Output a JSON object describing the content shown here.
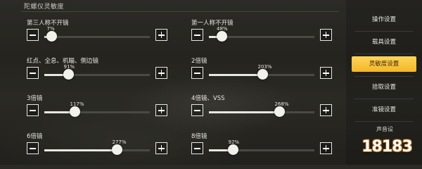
{
  "section_title": "陀螺仪灵敏度",
  "settings": [
    {
      "label": "第三人称不开镜",
      "value_text": "7%",
      "level": 0.07
    },
    {
      "label": "第一人称不开镜",
      "value_text": "48%",
      "level": 0.12
    },
    {
      "label": "红点、全息、机瞄、侧边镜",
      "value_text": "91%",
      "level": 0.23
    },
    {
      "label": "2倍镜",
      "value_text": "203%",
      "level": 0.51
    },
    {
      "label": "3倍镜",
      "value_text": "117%",
      "level": 0.29
    },
    {
      "label": "4倍镜、VSS",
      "value_text": "268%",
      "level": 0.67
    },
    {
      "label": "6倍镜",
      "value_text": "277%",
      "level": 0.69
    },
    {
      "label": "8倍镜",
      "value_text": "92%",
      "level": 0.23
    }
  ],
  "sidebar": {
    "items": [
      {
        "label": "操作设置",
        "active": false
      },
      {
        "label": "载具设置",
        "active": false
      },
      {
        "label": "灵敏度设置",
        "active": true
      },
      {
        "label": "拾取设置",
        "active": false
      },
      {
        "label": "准镜设置",
        "active": false
      },
      {
        "label": "声音设",
        "active": false
      }
    ]
  },
  "watermark": "18183",
  "colors": {
    "accent": "#f5bd2e",
    "text": "#e8e8e2"
  }
}
